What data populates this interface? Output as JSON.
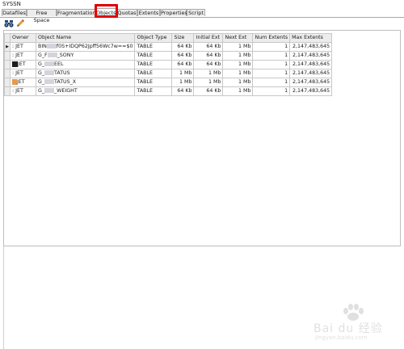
{
  "window": {
    "title": "SYSSN"
  },
  "tabs": [
    {
      "label": "Datafiles",
      "active": false
    },
    {
      "label": "Free Space",
      "active": false
    },
    {
      "label": "Fragmentation",
      "active": false
    },
    {
      "label": "Objects",
      "active": true
    },
    {
      "label": "Quotas",
      "active": false
    },
    {
      "label": "Extents",
      "active": false
    },
    {
      "label": "Properties",
      "active": false
    },
    {
      "label": "Script",
      "active": false
    }
  ],
  "toolbar": {
    "icons": [
      "binoculars-icon",
      "pencil-icon"
    ]
  },
  "grid": {
    "columns": [
      "Owner",
      "Object Name",
      "Object Type",
      "Size",
      "Initial Ext",
      "Next Ext",
      "Num Extents",
      "Max Extents"
    ],
    "rows": [
      {
        "owner": "JET",
        "name_prefix": "BIN",
        "name_suffix": "f0S+IDQP62Jpff56Wc7w==$0",
        "type": "TABLE",
        "size": "64 Kb",
        "initial": "64 Kb",
        "next": "1 Mb",
        "num": "1",
        "max": "2,147,483,645"
      },
      {
        "owner": "JET",
        "name_prefix": "G_F",
        "name_suffix": "_SONY",
        "type": "TABLE",
        "size": "64 Kb",
        "initial": "64 Kb",
        "next": "1 Mb",
        "num": "1",
        "max": "2,147,483,645"
      },
      {
        "owner": "JET",
        "name_prefix": "G_",
        "name_suffix": "EEL",
        "type": "TABLE",
        "size": "64 Kb",
        "initial": "64 Kb",
        "next": "1 Mb",
        "num": "1",
        "max": "2,147,483,645"
      },
      {
        "owner": "JET",
        "name_prefix": "G_",
        "name_suffix": "TATUS",
        "type": "TABLE",
        "size": "1 Mb",
        "initial": "1 Mb",
        "next": "1 Mb",
        "num": "1",
        "max": "2,147,483,645"
      },
      {
        "owner": "JET",
        "name_prefix": "G_",
        "name_suffix": "TATUS_X",
        "type": "TABLE",
        "size": "1 Mb",
        "initial": "1 Mb",
        "next": "1 Mb",
        "num": "1",
        "max": "2,147,483,645"
      },
      {
        "owner": "JET",
        "name_prefix": "G_",
        "name_suffix": "_WEIGHT",
        "type": "TABLE",
        "size": "64 Kb",
        "initial": "64 Kb",
        "next": "1 Mb",
        "num": "1",
        "max": "2,147,483,645"
      }
    ]
  },
  "watermark": {
    "text": "Bai du 经验",
    "sub": "jingyan.baidu.com"
  },
  "colors": {
    "highlight": "#e00000",
    "tab_bg": "#ececec",
    "border": "#a8a8a8"
  }
}
